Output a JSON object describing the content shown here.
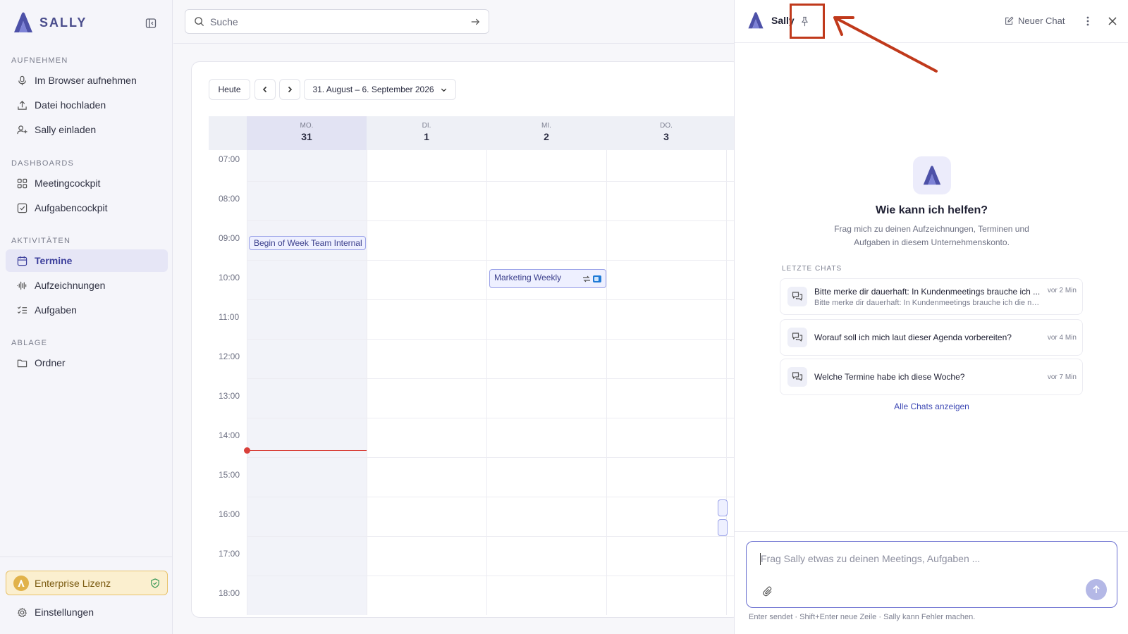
{
  "brand": {
    "name": "SALLY"
  },
  "sidebar": {
    "sections": {
      "record": "AUFNEHMEN",
      "dashboards": "DASHBOARDS",
      "activities": "AKTIVITÄTEN",
      "storage": "ABLAGE"
    },
    "items": [
      {
        "label": "Im Browser aufnehmen",
        "icon": "microphone-icon"
      },
      {
        "label": "Datei hochladen",
        "icon": "upload-icon"
      },
      {
        "label": "Sally einladen",
        "icon": "user-plus-icon"
      },
      {
        "label": "Meetingcockpit",
        "icon": "grid-icon"
      },
      {
        "label": "Aufgabencockpit",
        "icon": "checkbox-icon"
      },
      {
        "label": "Termine",
        "icon": "calendar-icon",
        "active": true
      },
      {
        "label": "Aufzeichnungen",
        "icon": "waveform-icon"
      },
      {
        "label": "Aufgaben",
        "icon": "checklist-icon"
      },
      {
        "label": "Ordner",
        "icon": "folder-icon"
      }
    ],
    "license": "Enterprise Lizenz",
    "settings": "Einstellungen"
  },
  "search": {
    "placeholder": "Suche"
  },
  "calendar": {
    "today": "Heute",
    "range": "31. August – 6. September 2026",
    "days": [
      {
        "name": "MO.",
        "date": "31"
      },
      {
        "name": "DI.",
        "date": "1"
      },
      {
        "name": "MI.",
        "date": "2"
      },
      {
        "name": "DO.",
        "date": "3"
      }
    ],
    "hours": [
      "07:00",
      "08:00",
      "09:00",
      "10:00",
      "11:00",
      "12:00",
      "13:00",
      "14:00",
      "15:00",
      "16:00",
      "17:00",
      "18:00"
    ],
    "events": [
      {
        "title": "Begin of Week Team Internal"
      },
      {
        "title": "Marketing Weekly"
      }
    ]
  },
  "chat": {
    "title": "Sally",
    "new_chat": "Neuer Chat",
    "heading": "Wie kann ich helfen?",
    "subtitle_line1": "Frag mich zu deinen Aufzeichnungen, Terminen und",
    "subtitle_line2": "Aufgaben in diesem Unternehmenskonto.",
    "recent_label": "LETZTE CHATS",
    "recent": [
      {
        "title": "Bitte merke dir dauerhaft: In Kundenmeetings brauche ich ...",
        "preview": "Bitte merke dir dauerhaft: In Kundenmeetings brauche ich die nächsten S...",
        "time": "vor 2 Min"
      },
      {
        "title": "Worauf soll ich mich laut dieser Agenda vorbereiten?",
        "preview": "",
        "time": "vor 4 Min"
      },
      {
        "title": "Welche Termine habe ich diese Woche?",
        "preview": "",
        "time": "vor 7 Min"
      }
    ],
    "all_chats": "Alle Chats anzeigen",
    "input_placeholder": "Frag Sally etwas zu deinen Meetings, Aufgaben ...",
    "hint": "Enter sendet · Shift+Enter neue Zeile · Sally kann Fehler machen."
  },
  "colors": {
    "accent": "#4a4d9c",
    "annotation": "#c0391b",
    "now_line": "#d9403a"
  }
}
